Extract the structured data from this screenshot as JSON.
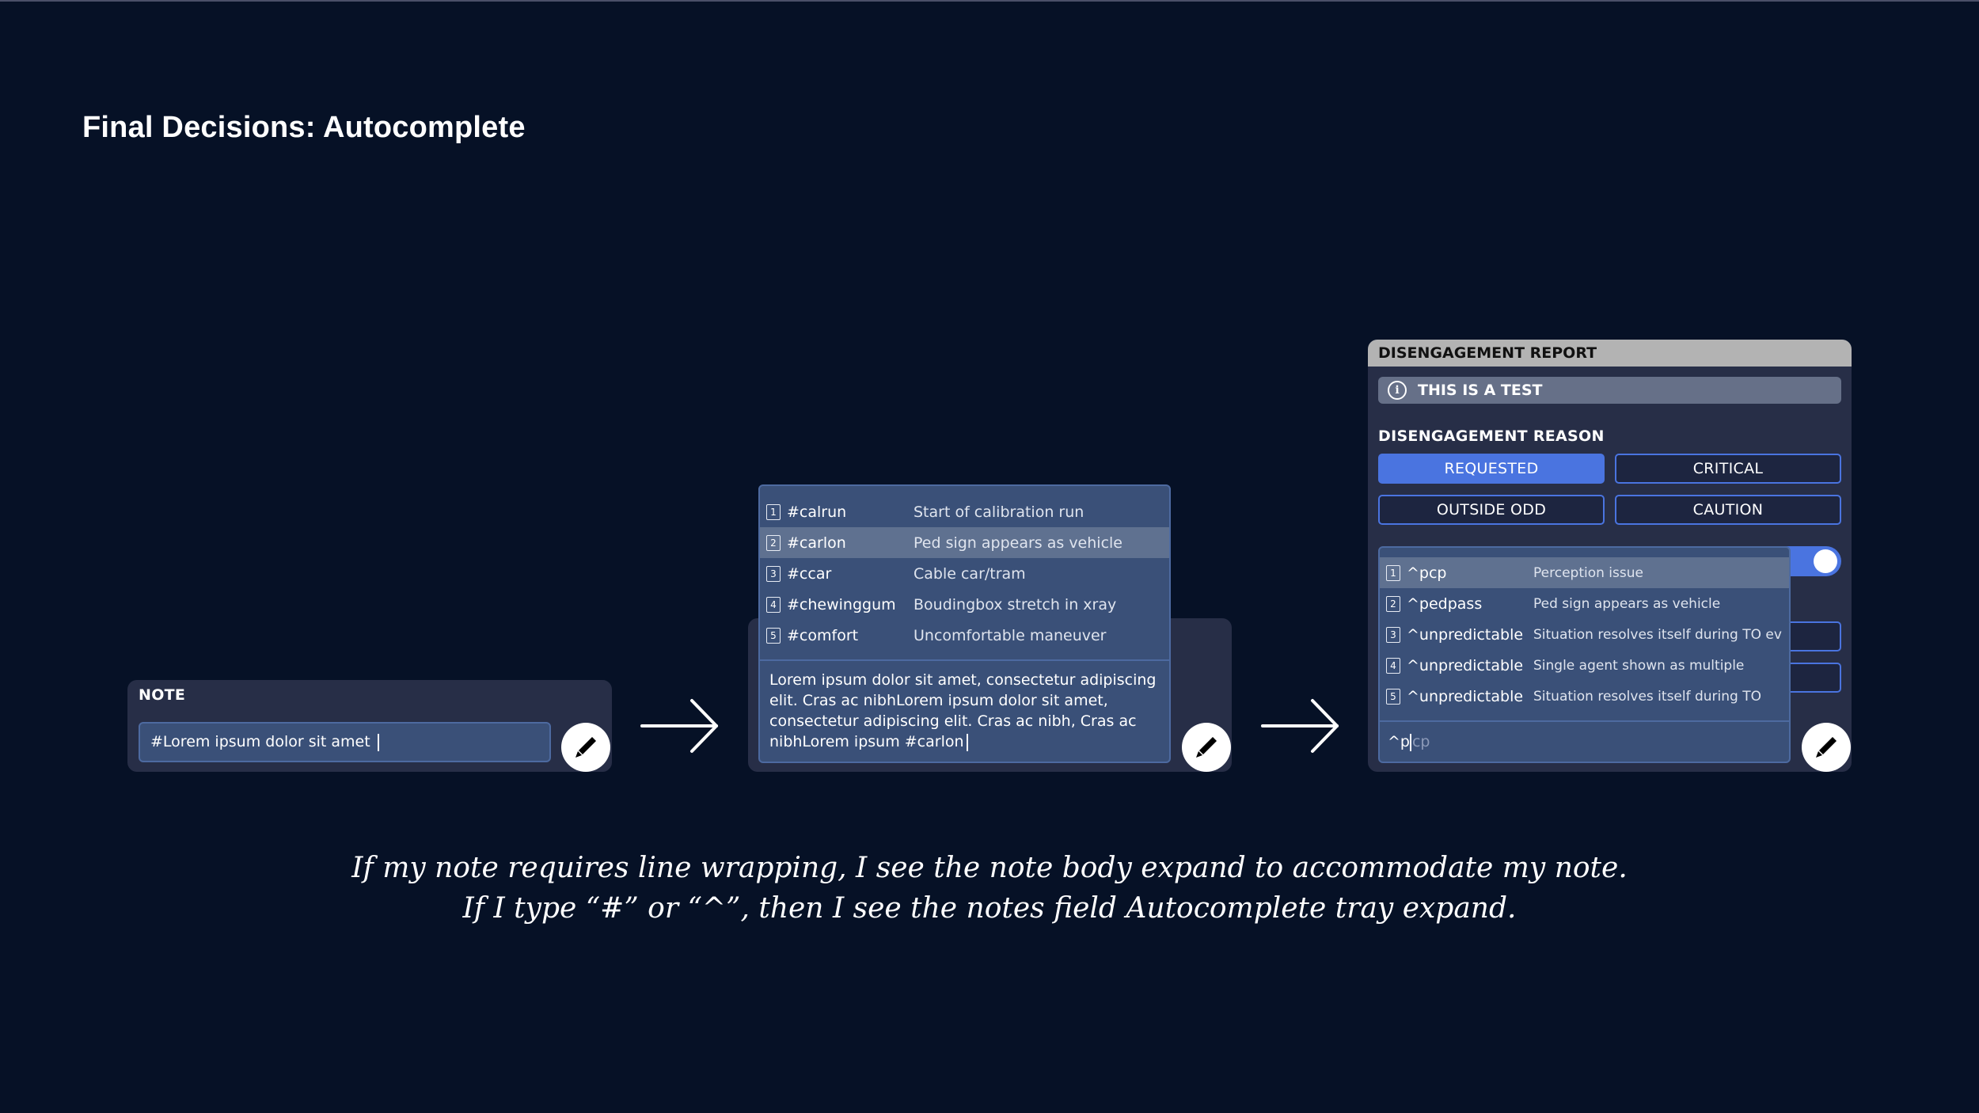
{
  "slide": {
    "title": "Final Decisions: Autocomplete",
    "caption_line1": "If my note requires line wrapping, I see the note body expand to accommodate my note.",
    "caption_line2": "If I type “#” or “^”, then I see the notes field Autocomplete tray expand."
  },
  "colors": {
    "background": "#061126",
    "panel": "#272e47",
    "input": "#3a5078",
    "highlight": "#5f7190",
    "accent": "#4a74e0",
    "header": "#b3b3b3"
  },
  "panel1": {
    "label": "NOTE",
    "input_value": "#Lorem ipsum dolor sit amet ",
    "edit_icon": "pencil-icon"
  },
  "panel2": {
    "suggestions": [
      {
        "key": "1",
        "tag": "#calrun",
        "desc": "Start of calibration run"
      },
      {
        "key": "2",
        "tag": "#carlon",
        "desc": "Ped sign appears as vehicle"
      },
      {
        "key": "3",
        "tag": "#ccar",
        "desc": "Cable car/tram"
      },
      {
        "key": "4",
        "tag": "#chewinggum",
        "desc": "Boudingbox stretch in xray"
      },
      {
        "key": "5",
        "tag": "#comfort",
        "desc": "Uncomfortable maneuver"
      }
    ],
    "highlighted_index": 1,
    "note_lines": [
      "Lorem ipsum dolor sit amet, consectetur adipiscing",
      "elit. Cras ac nibhLorem ipsum dolor sit amet,",
      "consectetur adipiscing elit. Cras ac nibh, Cras ac",
      "nibhLorem ipsum #carlon"
    ],
    "edit_icon": "pencil-icon"
  },
  "panel3": {
    "header": "DISENGAGEMENT REPORT",
    "info_text": "THIS IS A TEST",
    "info_icon": "info-icon",
    "reason_label": "DISENGAGEMENT REASON",
    "reasons": [
      {
        "label": "REQUESTED",
        "selected": true
      },
      {
        "label": "CRITICAL",
        "selected": false
      },
      {
        "label": "OUTSIDE ODD",
        "selected": false
      },
      {
        "label": "CAUTION",
        "selected": false
      }
    ],
    "toggle_on": true,
    "suggestions": [
      {
        "key": "1",
        "tag": "^pcp",
        "desc": "Perception issue"
      },
      {
        "key": "2",
        "tag": "^pedpass",
        "desc": "Ped sign appears as vehicle"
      },
      {
        "key": "3",
        "tag": "^unpredictable",
        "desc": "Situation resolves itself during TO ev"
      },
      {
        "key": "4",
        "tag": "^unpredictable",
        "desc": "Single agent shown as multiple"
      },
      {
        "key": "5",
        "tag": "^unpredictable",
        "desc": "Situation resolves itself during TO"
      }
    ],
    "highlighted_index": 0,
    "input_typed": "^p",
    "input_ghost": "cp",
    "edit_icon": "pencil-icon"
  }
}
